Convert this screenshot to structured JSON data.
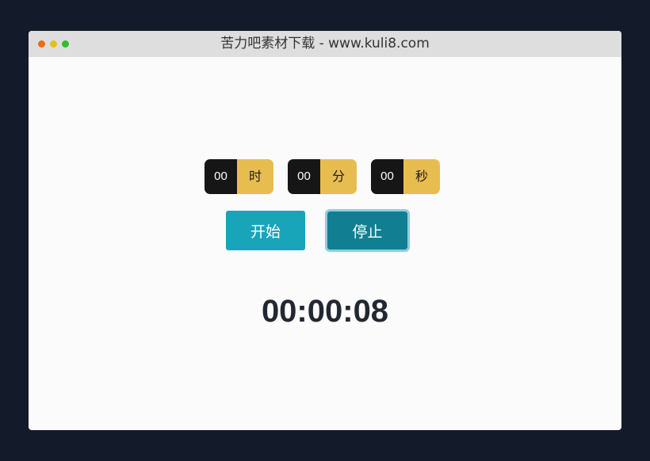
{
  "window": {
    "title": "苦力吧素材下载 - www.kuli8.com"
  },
  "timer": {
    "fields": [
      {
        "value": "00",
        "unit": "时"
      },
      {
        "value": "00",
        "unit": "分"
      },
      {
        "value": "00",
        "unit": "秒"
      }
    ],
    "start_label": "开始",
    "stop_label": "停止",
    "display": "00:00:08"
  },
  "colors": {
    "field_value_bg": "#161616",
    "field_unit_bg": "#e8bd4f",
    "start_button": "#18a5ba",
    "stop_button": "#117f91"
  }
}
